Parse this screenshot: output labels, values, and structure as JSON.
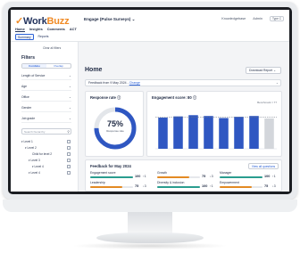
{
  "app": {
    "brand_prefix": "Work",
    "brand_suffix": "Buzz",
    "survey_select": "Engage (Pulse Surveys) ⌄"
  },
  "header": {
    "links": [
      "Knowledgebase",
      "Admin"
    ],
    "type_input_placeholder": "Type C"
  },
  "nav": {
    "tabs": [
      "Home",
      "Insights",
      "Comments",
      "ACT"
    ],
    "active_tab": "Home",
    "subtabs": [
      "Summary",
      "Reports"
    ],
    "active_subtab": "Summary"
  },
  "sidebar": {
    "clear_filters": "Clear all filters",
    "title": "Filters",
    "toggle": [
      "Combine",
      "Overlap"
    ],
    "filter_items": [
      "Length of Service",
      "Age",
      "Office",
      "Gender",
      "Job grade"
    ],
    "search_placeholder": "Search hierarchy",
    "hierarchy": [
      "Level 1",
      "Level 2",
      "Child for level 2",
      "Level 3",
      "Level 4",
      "Level 4"
    ]
  },
  "main": {
    "title": "Home",
    "download_label": "Download Report ⌄",
    "feedback_text": "Feedback from 9 May 2024 - ",
    "feedback_change": "Change"
  },
  "response_rate": {
    "title": "Response rate ⓘ",
    "value": "75%",
    "sub": "Response rate",
    "fraction": 0.75
  },
  "engagement": {
    "title": "Engagement score: 80 ⓘ",
    "benchmark_label": "Benchmark = 77"
  },
  "chart_data": {
    "type": "bar",
    "title": "Engagement score: 80",
    "categories": [
      "",
      "",
      "",
      "",
      "",
      "",
      "",
      ""
    ],
    "values": [
      76,
      79,
      82,
      80,
      75,
      78,
      80,
      74
    ],
    "benchmark": 77,
    "ylim": [
      0,
      100
    ],
    "colors": [
      "#2f57c2",
      "#2f57c2",
      "#2f57c2",
      "#2f57c2",
      "#2f57c2",
      "#2f57c2",
      "#2f57c2",
      "#d3d6db"
    ]
  },
  "feedback": {
    "title": "Feedback for May 2024",
    "link": "View all questions",
    "metrics": [
      {
        "name": "Engagement score",
        "score": "100",
        "delta": "↑1",
        "fill": 1.0,
        "color": "#2a9d8f"
      },
      {
        "name": "Growth",
        "score": "75",
        "delta": "↓3",
        "fill": 0.75,
        "color": "#e38a23"
      },
      {
        "name": "Manager",
        "score": "100",
        "delta": "↑1",
        "fill": 1.0,
        "color": "#2a9d8f"
      },
      {
        "name": "Leadership",
        "score": "75",
        "delta": "↓3",
        "fill": 0.75,
        "color": "#e38a23"
      },
      {
        "name": "Diversity & inclusion",
        "score": "100",
        "delta": "↑1",
        "fill": 1.0,
        "color": "#2a9d8f"
      },
      {
        "name": "Empowerment",
        "score": "75",
        "delta": "↓3",
        "fill": 0.75,
        "color": "#e38a23"
      }
    ]
  }
}
